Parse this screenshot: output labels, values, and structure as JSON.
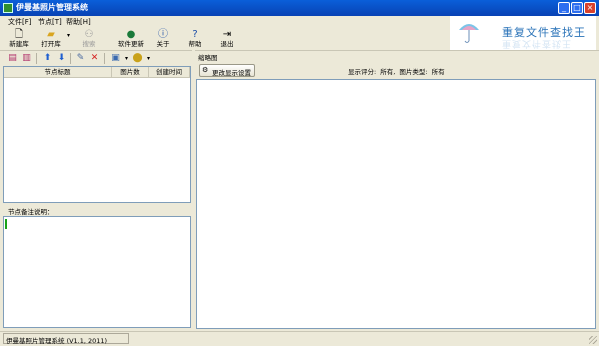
{
  "window": {
    "title": "伊曼基照片管理系统",
    "controls": {
      "minimize": "_",
      "maximize": "□",
      "close": "×"
    }
  },
  "menu": [
    {
      "label": "文件[F]"
    },
    {
      "label": "节点[T]"
    },
    {
      "label": "帮助[H]"
    }
  ],
  "toolbar": {
    "new_db": {
      "label": "新建库",
      "icon": "new-document-icon"
    },
    "open_db": {
      "label": "打开库",
      "icon": "folder-open-icon"
    },
    "search": {
      "label": "搜索",
      "icon": "binoculars-icon",
      "disabled": true
    },
    "update": {
      "label": "软件更新",
      "icon": "globe-icon"
    },
    "about": {
      "label": "关于",
      "icon": "info-icon"
    },
    "help": {
      "label": "帮助",
      "icon": "help-icon"
    },
    "exit": {
      "label": "退出",
      "icon": "exit-door-icon"
    }
  },
  "logo": {
    "text": "重复文件查找王"
  },
  "left_panel": {
    "tree_toolbar_icons": [
      "expand-all-icon",
      "collapse-all-icon",
      "move-up-icon",
      "move-down-icon",
      "edit-icon",
      "delete-icon",
      "image-dropdown-icon",
      "filter-dropdown-icon"
    ],
    "columns": [
      {
        "label": "节点标题"
      },
      {
        "label": "图片数"
      },
      {
        "label": "创建时间"
      }
    ],
    "rows": [],
    "note_label": "节点备注说明：",
    "note_text": ""
  },
  "right_panel": {
    "tab_title": "缩略图",
    "change_display_button": "更改显示设置",
    "display_info": "显示评分: 所有, 图片类型: 所有"
  },
  "status": {
    "text": "伊曼基照片管理系统 (V1.1, 2011)"
  },
  "colors": {
    "titlebar": "#0a5fd9",
    "accent_blue": "#2a73b8",
    "caret_green": "#19a319"
  }
}
